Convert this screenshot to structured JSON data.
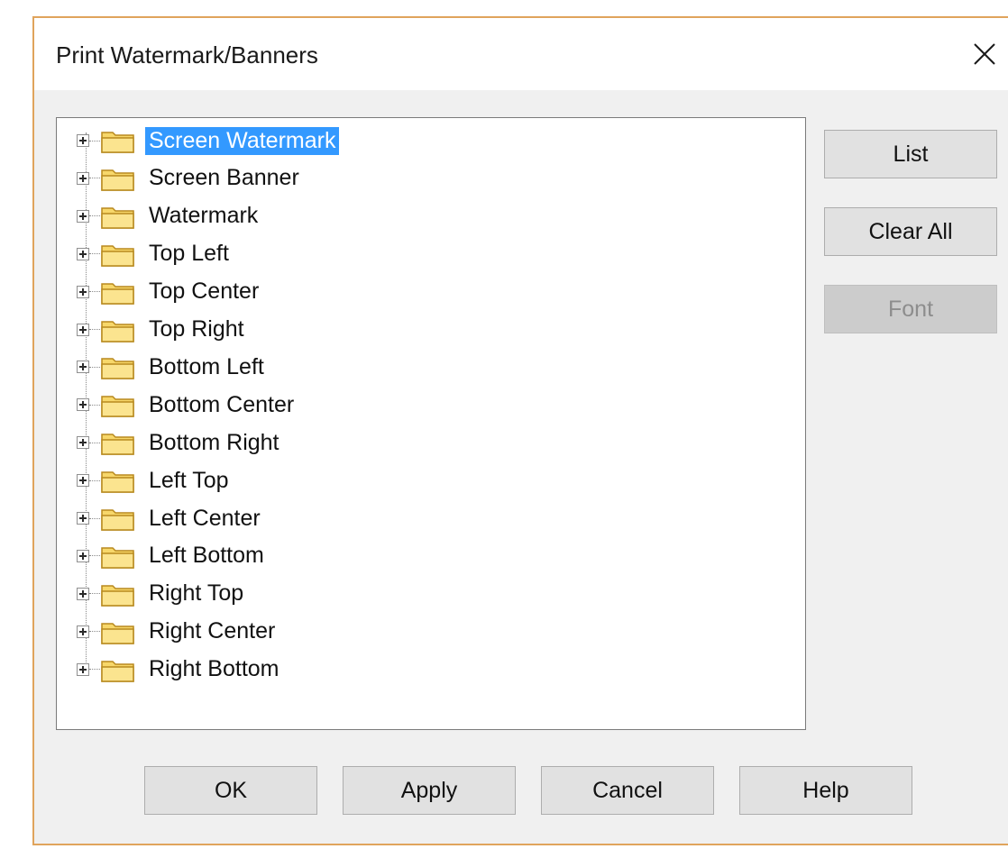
{
  "window": {
    "title": "Print Watermark/Banners",
    "close_icon": "close-icon"
  },
  "tree": {
    "icons": {
      "expander": "plus-box-icon",
      "folder": "folder-icon"
    },
    "selected_index": 0,
    "items": [
      {
        "label": "Screen Watermark"
      },
      {
        "label": "Screen Banner"
      },
      {
        "label": "Watermark"
      },
      {
        "label": "Top Left"
      },
      {
        "label": "Top Center"
      },
      {
        "label": "Top Right"
      },
      {
        "label": "Bottom Left"
      },
      {
        "label": "Bottom Center"
      },
      {
        "label": "Bottom Right"
      },
      {
        "label": "Left Top"
      },
      {
        "label": "Left Center"
      },
      {
        "label": "Left Bottom"
      },
      {
        "label": "Right Top"
      },
      {
        "label": "Right Center"
      },
      {
        "label": "Right Bottom"
      }
    ]
  },
  "side_buttons": {
    "list": {
      "label": "List",
      "enabled": true
    },
    "clear_all": {
      "label": "Clear All",
      "enabled": true
    },
    "font": {
      "label": "Font",
      "enabled": false
    }
  },
  "footer_buttons": {
    "ok": "OK",
    "apply": "Apply",
    "cancel": "Cancel",
    "help": "Help"
  },
  "colors": {
    "selection": "#3399ff",
    "window_border": "#e0a45c",
    "folder_fill": "#f7d76a",
    "folder_stroke": "#b8891e"
  }
}
